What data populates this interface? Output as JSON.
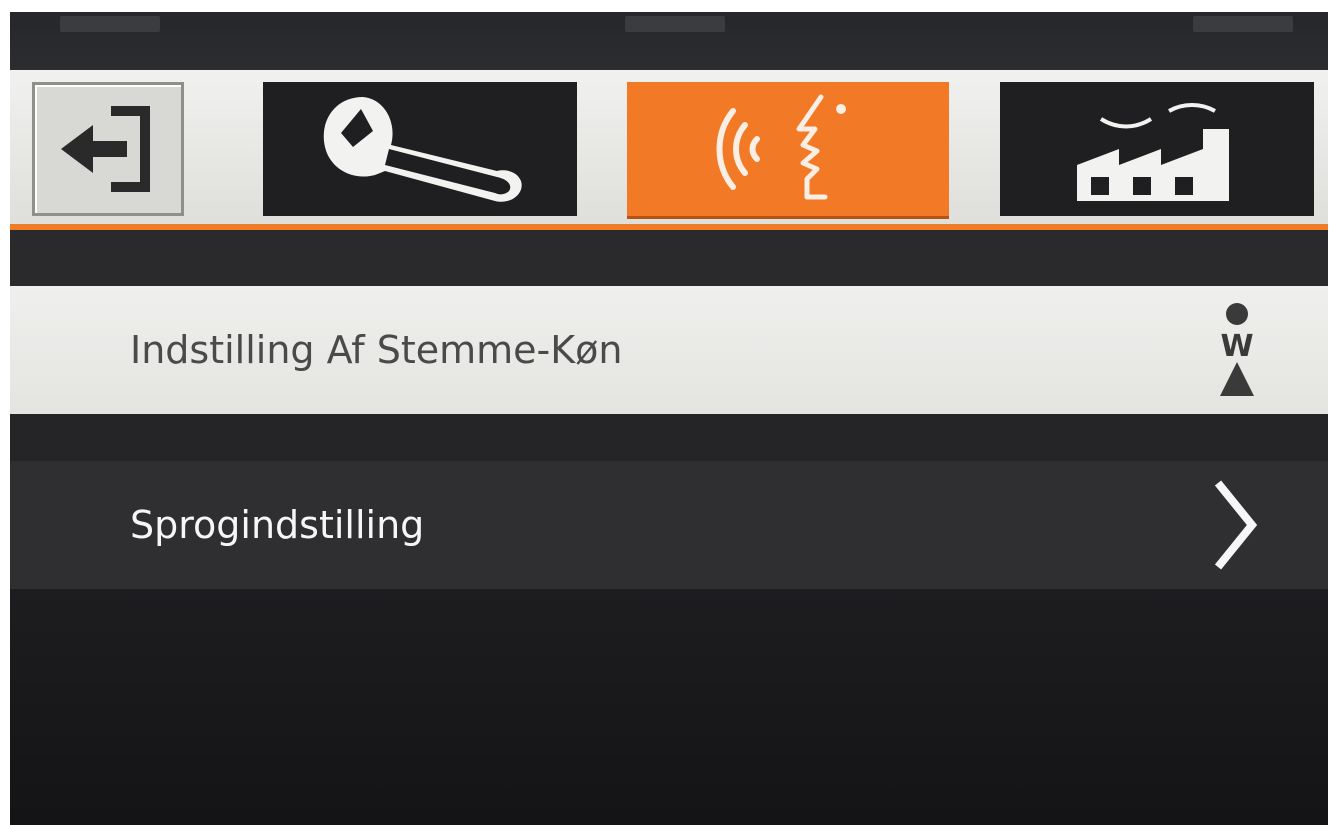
{
  "colors": {
    "accent": "#f27a27",
    "tab_dark": "#1f1f21",
    "row_light": "#ececea",
    "row_dark": "#2f2f32"
  },
  "tabs": [
    {
      "name": "exit",
      "icon": "exit-arrow-icon",
      "selected": false
    },
    {
      "name": "settings",
      "icon": "wrench-icon",
      "selected": false
    },
    {
      "name": "voice",
      "icon": "speech-voice-icon",
      "selected": true
    },
    {
      "name": "factory",
      "icon": "factory-icon",
      "selected": false
    }
  ],
  "menu": {
    "items": [
      {
        "label": "Indstilling Af Stemme-Køn",
        "icon": "voice-gender-icon",
        "icon_text": "W"
      },
      {
        "label": "Sprogindstilling",
        "icon": "chevron-right-icon"
      }
    ]
  }
}
